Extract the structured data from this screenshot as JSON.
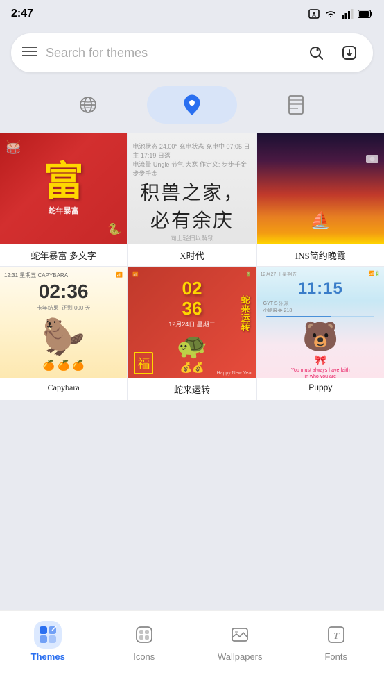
{
  "statusBar": {
    "time": "2:47",
    "icons": [
      "wifi",
      "signal",
      "battery"
    ]
  },
  "searchBar": {
    "placeholder": "Search for themes",
    "menuIcon": "≡",
    "searchIcon": "🔍",
    "downloadIcon": "⬇"
  },
  "tabs": [
    {
      "id": "global",
      "icon": "🌐",
      "active": false
    },
    {
      "id": "location",
      "icon": "📍",
      "active": true
    },
    {
      "id": "bookmark",
      "icon": "🔖",
      "active": false
    }
  ],
  "themes": [
    {
      "id": 1,
      "label": "蛇年暴富 多文字",
      "type": "cny-red"
    },
    {
      "id": 2,
      "label": "X时代",
      "type": "minimalist"
    },
    {
      "id": 3,
      "label": "INS简约晚霞",
      "type": "sunset"
    },
    {
      "id": 4,
      "label": "Capybara",
      "type": "capybara"
    },
    {
      "id": 5,
      "label": "蛇来运转",
      "type": "cny-turtle"
    },
    {
      "id": 6,
      "label": "Puppy",
      "type": "puppy"
    }
  ],
  "bottomNav": [
    {
      "id": "themes",
      "label": "Themes",
      "active": true
    },
    {
      "id": "icons",
      "label": "Icons",
      "active": false
    },
    {
      "id": "wallpapers",
      "label": "Wallpapers",
      "active": false
    },
    {
      "id": "fonts",
      "label": "Fonts",
      "active": false
    }
  ]
}
